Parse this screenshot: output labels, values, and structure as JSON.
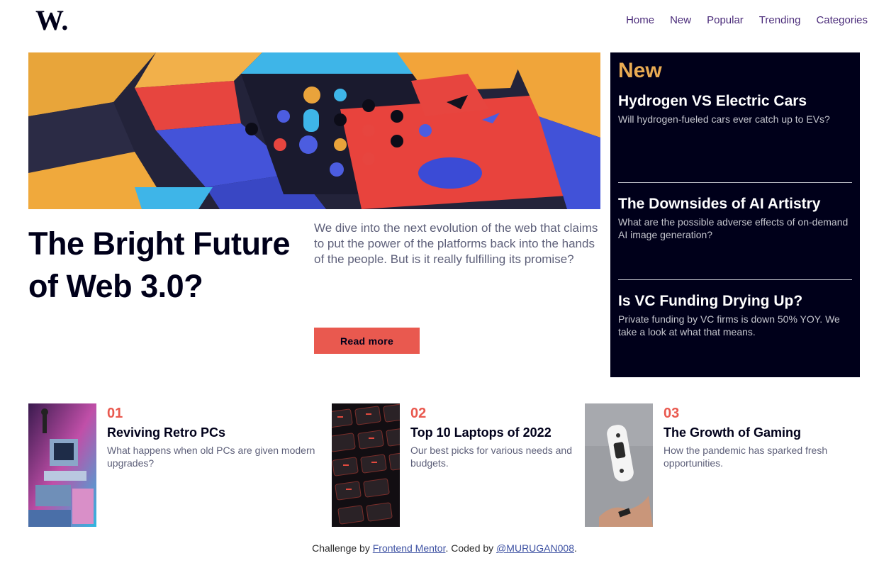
{
  "header": {
    "logo_text": "W.",
    "nav": [
      "Home",
      "New",
      "Popular",
      "Trending",
      "Categories"
    ]
  },
  "hero": {
    "title": "The Bright Future of Web 3.0?",
    "description": "We dive into the next evolution of the web that claims to put the power of the platforms back into the hands of the people. But is it really fulfilling its promise?",
    "cta": "Read more"
  },
  "new_panel": {
    "heading": "New",
    "items": [
      {
        "title": "Hydrogen VS Electric Cars",
        "desc": "Will hydrogen-fueled cars ever catch up to EVs?"
      },
      {
        "title": "The Downsides of AI Artistry",
        "desc": "What are the possible adverse effects of on-demand AI image generation?"
      },
      {
        "title": "Is VC Funding Drying Up?",
        "desc": "Private funding by VC firms is down 50% YOY. We take a look at what that means."
      }
    ]
  },
  "cards": [
    {
      "num": "01",
      "title": "Reviving Retro PCs",
      "desc": "What happens when old PCs are given modern upgrades?"
    },
    {
      "num": "02",
      "title": "Top 10 Laptops of 2022",
      "desc": "Our best picks for various needs and budgets."
    },
    {
      "num": "03",
      "title": "The Growth of Gaming",
      "desc": "How the pandemic has sparked fresh opportunities."
    }
  ],
  "footer": {
    "prefix": "Challenge by ",
    "link1": "Frontend Mentor",
    "middle": ". Coded by ",
    "link2": "@MURUGAN008",
    "suffix": "."
  },
  "colors": {
    "accent_red": "#e9594f",
    "accent_orange": "#e9ab53",
    "dark_navy": "#00001a",
    "nav_purple": "#4b2c7a"
  }
}
